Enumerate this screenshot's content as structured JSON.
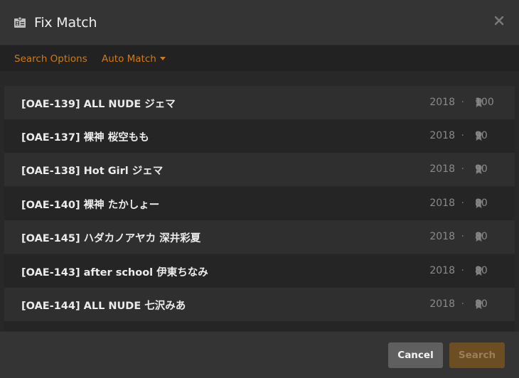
{
  "dialog": {
    "title": "Fix Match",
    "icon": "id-card-icon",
    "close_icon": "close-icon"
  },
  "tabs": [
    {
      "label": "Search Options",
      "has_dropdown": false
    },
    {
      "label": "Auto Match",
      "has_dropdown": true
    }
  ],
  "accent_color": "#cc7b19",
  "results": [
    {
      "title": "[OAE-139] ALL NUDE ジェマ",
      "year": "2018",
      "score": "100"
    },
    {
      "title": "[OAE-137] 裸神 桜空もも",
      "year": "2018",
      "score": "90"
    },
    {
      "title": "[OAE-138] Hot Girl ジェマ",
      "year": "2018",
      "score": "90"
    },
    {
      "title": "[OAE-140] 裸神 たかしょー",
      "year": "2018",
      "score": "80"
    },
    {
      "title": "[OAE-145] ハダカノアヤカ 深井彩夏",
      "year": "2018",
      "score": "80"
    },
    {
      "title": "[OAE-143] after school 伊東ちなみ",
      "year": "2018",
      "score": "80"
    },
    {
      "title": "[OAE-144] ALL NUDE 七沢みあ",
      "year": "2018",
      "score": "80"
    }
  ],
  "separator": "·",
  "score_icon": "award-ribbon-icon",
  "footer": {
    "cancel_label": "Cancel",
    "search_label": "Search"
  }
}
